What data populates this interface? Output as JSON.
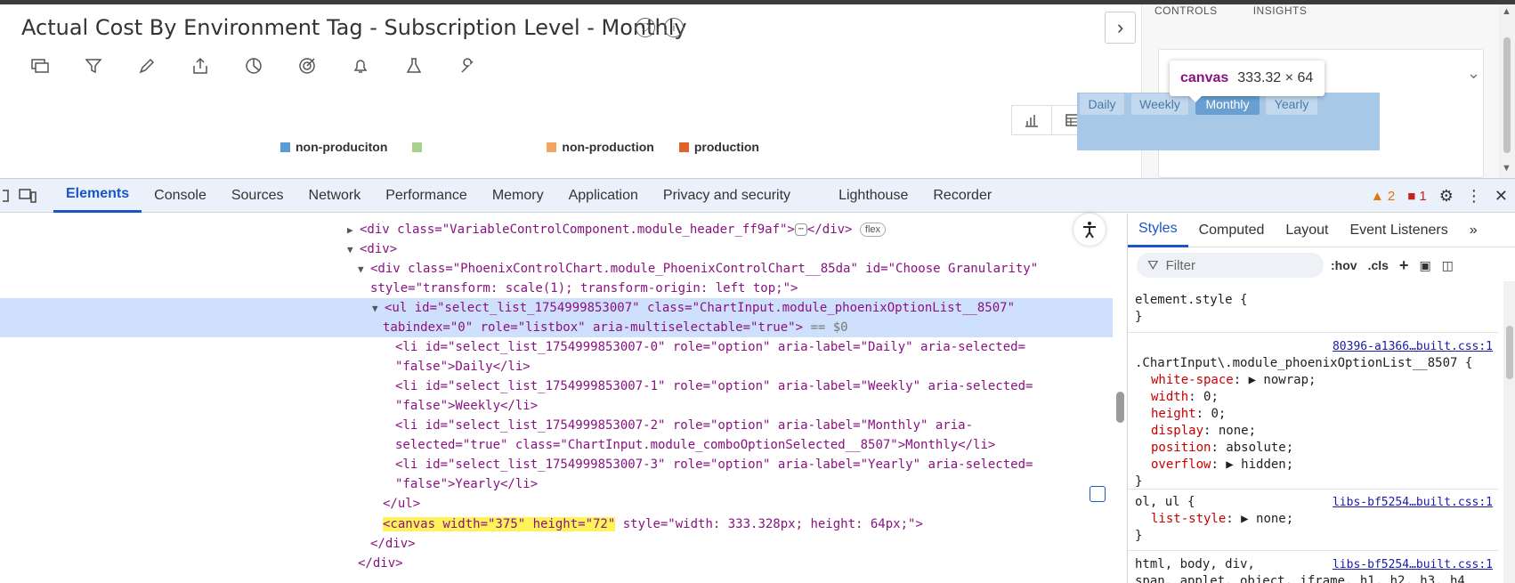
{
  "app": {
    "title": "Actual Cost By Environment Tag - Subscription Level - Monthly",
    "legend": [
      {
        "label": "non-produciton",
        "color": "#5b9bd5"
      },
      {
        "label": "",
        "color": "#a9d18e"
      },
      {
        "label": "non-production",
        "color": "#f4a460"
      },
      {
        "label": "production",
        "color": "#e2622b"
      }
    ],
    "right_panel": {
      "tabs": [
        "CONTROLS",
        "INSIGHTS"
      ],
      "granularity": [
        {
          "label": "Daily",
          "selected": false
        },
        {
          "label": "Weekly",
          "selected": false
        },
        {
          "label": "Monthly",
          "selected": true
        },
        {
          "label": "Yearly",
          "selected": false
        }
      ]
    },
    "tooltip": {
      "tag": "canvas",
      "size": "333.32 × 64"
    }
  },
  "devtools": {
    "tabs": [
      "Elements",
      "Console",
      "Sources",
      "Network",
      "Performance",
      "Memory",
      "Application",
      "Privacy and security",
      "Lighthouse",
      "Recorder"
    ],
    "warnings": "2",
    "errors": "1",
    "styles_tabs": [
      "Styles",
      "Computed",
      "Layout",
      "Event Listeners"
    ],
    "filter_placeholder": "Filter",
    "hov": ":hov",
    "cls": ".cls",
    "dom": {
      "l0_text": "<div class=\"VariableControlComponent.module_header_ff9af\">",
      "l0_close": "</div>",
      "l0_badge": "flex",
      "l1": "<div>",
      "l2a": "<div class=\"PhoenixControlChart.module_PhoenixControlChart__85da\" id=\"Choose Granularity\"",
      "l2b": "style=\"transform: scale(1); transform-origin: left top;\">",
      "l3a": "<ul id=\"select_list_1754999853007\" class=\"ChartInput.module_phoenixOptionList__8507\"",
      "l3b": "tabindex=\"0\" role=\"listbox\" aria-multiselectable=\"true\">",
      "l3_eq": "== $0",
      "li0a": "<li id=\"select_list_1754999853007-0\" role=\"option\" aria-label=\"Daily\" aria-selected=",
      "li0b": "\"false\">Daily</li>",
      "li1a": "<li id=\"select_list_1754999853007-1\" role=\"option\" aria-label=\"Weekly\" aria-selected=",
      "li1b": "\"false\">Weekly</li>",
      "li2a": "<li id=\"select_list_1754999853007-2\" role=\"option\" aria-label=\"Monthly\" aria-",
      "li2b": "selected=\"true\" class=\"ChartInput.module_comboOptionSelected__8507\">Monthly</li>",
      "li3a": "<li id=\"select_list_1754999853007-3\" role=\"option\" aria-label=\"Yearly\" aria-selected=",
      "li3b": "\"false\">Yearly</li>",
      "ul_close": "</ul>",
      "canvas_hl": "<canvas width=\"375\" height=\"72\"",
      "canvas_rest": " style=\"width: 333.328px; height: 64px;\">",
      "div_close1": "</div>",
      "div_close2": "</div>"
    },
    "styles": {
      "element_style": "element.style {",
      "close": "}",
      "rule1_src": "80396-a1366…built.css:1",
      "rule1_sel": ".ChartInput\\.module_phoenixOptionList__8507 {",
      "rule1_props": [
        {
          "name": "white-space",
          "value": "▶ nowrap;"
        },
        {
          "name": "width",
          "value": "0;"
        },
        {
          "name": "height",
          "value": "0;"
        },
        {
          "name": "display",
          "value": "none;"
        },
        {
          "name": "position",
          "value": "absolute;"
        },
        {
          "name": "overflow",
          "value": "▶ hidden;"
        }
      ],
      "rule2_src": "libs-bf5254…built.css:1",
      "rule2_sel": "ol, ul {",
      "rule2_prop_name": "list-style",
      "rule2_prop_value": "▶ none;",
      "rule3_src": "libs-bf5254…built.css:1",
      "rule3_sel": "html, body, div,",
      "rule3_sel2": "span, applet, object, iframe, h1, h2, h3, h4"
    }
  }
}
